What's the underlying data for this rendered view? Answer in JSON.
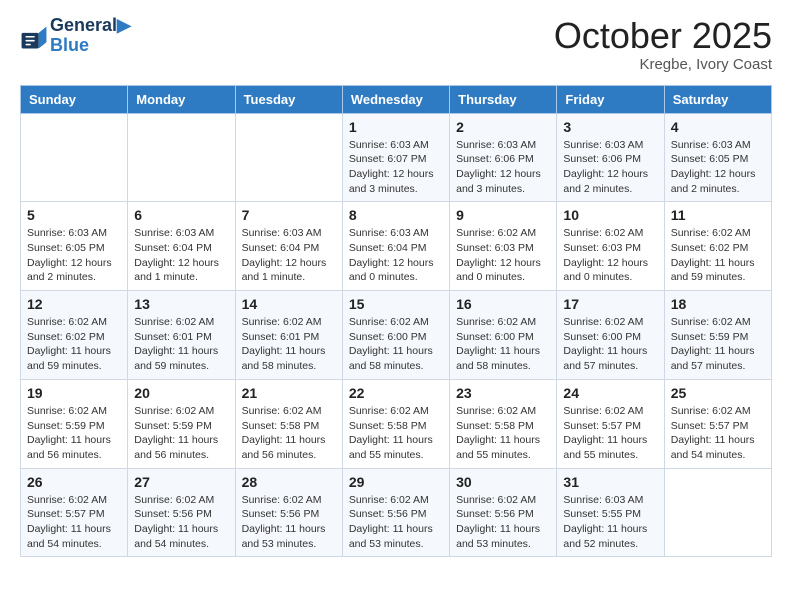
{
  "header": {
    "logo_line1": "General",
    "logo_line2": "Blue",
    "month": "October 2025",
    "location": "Kregbe, Ivory Coast"
  },
  "days_of_week": [
    "Sunday",
    "Monday",
    "Tuesday",
    "Wednesday",
    "Thursday",
    "Friday",
    "Saturday"
  ],
  "weeks": [
    [
      {
        "day": "",
        "info": ""
      },
      {
        "day": "",
        "info": ""
      },
      {
        "day": "",
        "info": ""
      },
      {
        "day": "1",
        "info": "Sunrise: 6:03 AM\nSunset: 6:07 PM\nDaylight: 12 hours\nand 3 minutes."
      },
      {
        "day": "2",
        "info": "Sunrise: 6:03 AM\nSunset: 6:06 PM\nDaylight: 12 hours\nand 3 minutes."
      },
      {
        "day": "3",
        "info": "Sunrise: 6:03 AM\nSunset: 6:06 PM\nDaylight: 12 hours\nand 2 minutes."
      },
      {
        "day": "4",
        "info": "Sunrise: 6:03 AM\nSunset: 6:05 PM\nDaylight: 12 hours\nand 2 minutes."
      }
    ],
    [
      {
        "day": "5",
        "info": "Sunrise: 6:03 AM\nSunset: 6:05 PM\nDaylight: 12 hours\nand 2 minutes."
      },
      {
        "day": "6",
        "info": "Sunrise: 6:03 AM\nSunset: 6:04 PM\nDaylight: 12 hours\nand 1 minute."
      },
      {
        "day": "7",
        "info": "Sunrise: 6:03 AM\nSunset: 6:04 PM\nDaylight: 12 hours\nand 1 minute."
      },
      {
        "day": "8",
        "info": "Sunrise: 6:03 AM\nSunset: 6:04 PM\nDaylight: 12 hours\nand 0 minutes."
      },
      {
        "day": "9",
        "info": "Sunrise: 6:02 AM\nSunset: 6:03 PM\nDaylight: 12 hours\nand 0 minutes."
      },
      {
        "day": "10",
        "info": "Sunrise: 6:02 AM\nSunset: 6:03 PM\nDaylight: 12 hours\nand 0 minutes."
      },
      {
        "day": "11",
        "info": "Sunrise: 6:02 AM\nSunset: 6:02 PM\nDaylight: 11 hours\nand 59 minutes."
      }
    ],
    [
      {
        "day": "12",
        "info": "Sunrise: 6:02 AM\nSunset: 6:02 PM\nDaylight: 11 hours\nand 59 minutes."
      },
      {
        "day": "13",
        "info": "Sunrise: 6:02 AM\nSunset: 6:01 PM\nDaylight: 11 hours\nand 59 minutes."
      },
      {
        "day": "14",
        "info": "Sunrise: 6:02 AM\nSunset: 6:01 PM\nDaylight: 11 hours\nand 58 minutes."
      },
      {
        "day": "15",
        "info": "Sunrise: 6:02 AM\nSunset: 6:00 PM\nDaylight: 11 hours\nand 58 minutes."
      },
      {
        "day": "16",
        "info": "Sunrise: 6:02 AM\nSunset: 6:00 PM\nDaylight: 11 hours\nand 58 minutes."
      },
      {
        "day": "17",
        "info": "Sunrise: 6:02 AM\nSunset: 6:00 PM\nDaylight: 11 hours\nand 57 minutes."
      },
      {
        "day": "18",
        "info": "Sunrise: 6:02 AM\nSunset: 5:59 PM\nDaylight: 11 hours\nand 57 minutes."
      }
    ],
    [
      {
        "day": "19",
        "info": "Sunrise: 6:02 AM\nSunset: 5:59 PM\nDaylight: 11 hours\nand 56 minutes."
      },
      {
        "day": "20",
        "info": "Sunrise: 6:02 AM\nSunset: 5:59 PM\nDaylight: 11 hours\nand 56 minutes."
      },
      {
        "day": "21",
        "info": "Sunrise: 6:02 AM\nSunset: 5:58 PM\nDaylight: 11 hours\nand 56 minutes."
      },
      {
        "day": "22",
        "info": "Sunrise: 6:02 AM\nSunset: 5:58 PM\nDaylight: 11 hours\nand 55 minutes."
      },
      {
        "day": "23",
        "info": "Sunrise: 6:02 AM\nSunset: 5:58 PM\nDaylight: 11 hours\nand 55 minutes."
      },
      {
        "day": "24",
        "info": "Sunrise: 6:02 AM\nSunset: 5:57 PM\nDaylight: 11 hours\nand 55 minutes."
      },
      {
        "day": "25",
        "info": "Sunrise: 6:02 AM\nSunset: 5:57 PM\nDaylight: 11 hours\nand 54 minutes."
      }
    ],
    [
      {
        "day": "26",
        "info": "Sunrise: 6:02 AM\nSunset: 5:57 PM\nDaylight: 11 hours\nand 54 minutes."
      },
      {
        "day": "27",
        "info": "Sunrise: 6:02 AM\nSunset: 5:56 PM\nDaylight: 11 hours\nand 54 minutes."
      },
      {
        "day": "28",
        "info": "Sunrise: 6:02 AM\nSunset: 5:56 PM\nDaylight: 11 hours\nand 53 minutes."
      },
      {
        "day": "29",
        "info": "Sunrise: 6:02 AM\nSunset: 5:56 PM\nDaylight: 11 hours\nand 53 minutes."
      },
      {
        "day": "30",
        "info": "Sunrise: 6:02 AM\nSunset: 5:56 PM\nDaylight: 11 hours\nand 53 minutes."
      },
      {
        "day": "31",
        "info": "Sunrise: 6:03 AM\nSunset: 5:55 PM\nDaylight: 11 hours\nand 52 minutes."
      },
      {
        "day": "",
        "info": ""
      }
    ]
  ]
}
